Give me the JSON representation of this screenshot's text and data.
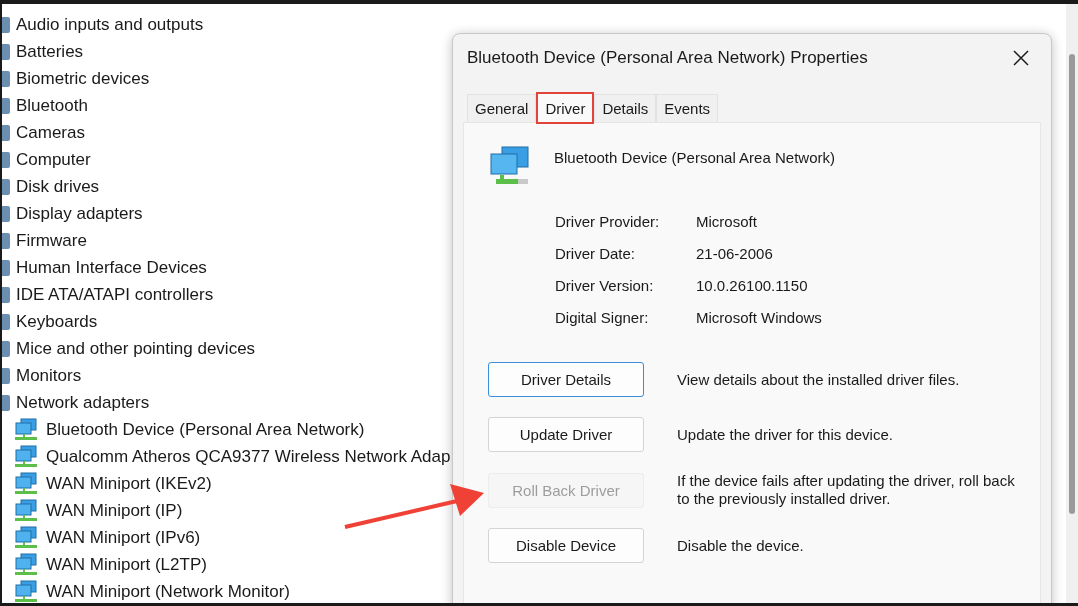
{
  "device_tree": [
    {
      "label": "Audio inputs and outputs"
    },
    {
      "label": "Batteries"
    },
    {
      "label": "Biometric devices"
    },
    {
      "label": "Bluetooth"
    },
    {
      "label": "Cameras"
    },
    {
      "label": "Computer"
    },
    {
      "label": "Disk drives"
    },
    {
      "label": "Display adapters"
    },
    {
      "label": "Firmware"
    },
    {
      "label": "Human Interface Devices"
    },
    {
      "label": "IDE ATA/ATAPI controllers"
    },
    {
      "label": "Keyboards"
    },
    {
      "label": "Mice and other pointing devices"
    },
    {
      "label": "Monitors"
    },
    {
      "label": "Network adapters",
      "children": [
        {
          "label": "Bluetooth Device (Personal Area Network)"
        },
        {
          "label": "Qualcomm Atheros QCA9377 Wireless Network Adap"
        },
        {
          "label": "WAN Miniport (IKEv2)"
        },
        {
          "label": "WAN Miniport (IP)"
        },
        {
          "label": "WAN Miniport (IPv6)"
        },
        {
          "label": "WAN Miniport (L2TP)"
        },
        {
          "label": "WAN Miniport (Network Monitor)"
        }
      ]
    }
  ],
  "dialog": {
    "title": "Bluetooth Device (Personal Area Network) Properties",
    "tabs": [
      {
        "label": "General",
        "selected": false,
        "highlighted": false
      },
      {
        "label": "Driver",
        "selected": true,
        "highlighted": true
      },
      {
        "label": "Details",
        "selected": false,
        "highlighted": false
      },
      {
        "label": "Events",
        "selected": false,
        "highlighted": false
      }
    ],
    "device_name": "Bluetooth Device (Personal Area Network)",
    "properties": [
      {
        "label": "Driver Provider:",
        "value": "Microsoft"
      },
      {
        "label": "Driver Date:",
        "value": "21-06-2006"
      },
      {
        "label": "Driver Version:",
        "value": "10.0.26100.1150"
      },
      {
        "label": "Digital Signer:",
        "value": "Microsoft Windows"
      }
    ],
    "actions": [
      {
        "button": "Driver Details",
        "description": "View details about the installed driver files.",
        "disabled": false,
        "focused": true
      },
      {
        "button": "Update Driver",
        "description": "Update the driver for this device.",
        "disabled": false,
        "focused": false
      },
      {
        "button": "Roll Back Driver",
        "description": "If the device fails after updating the driver, roll back to the previously installed driver.",
        "disabled": true,
        "focused": false
      },
      {
        "button": "Disable Device",
        "description": "Disable the device.",
        "disabled": false,
        "focused": false
      }
    ]
  }
}
